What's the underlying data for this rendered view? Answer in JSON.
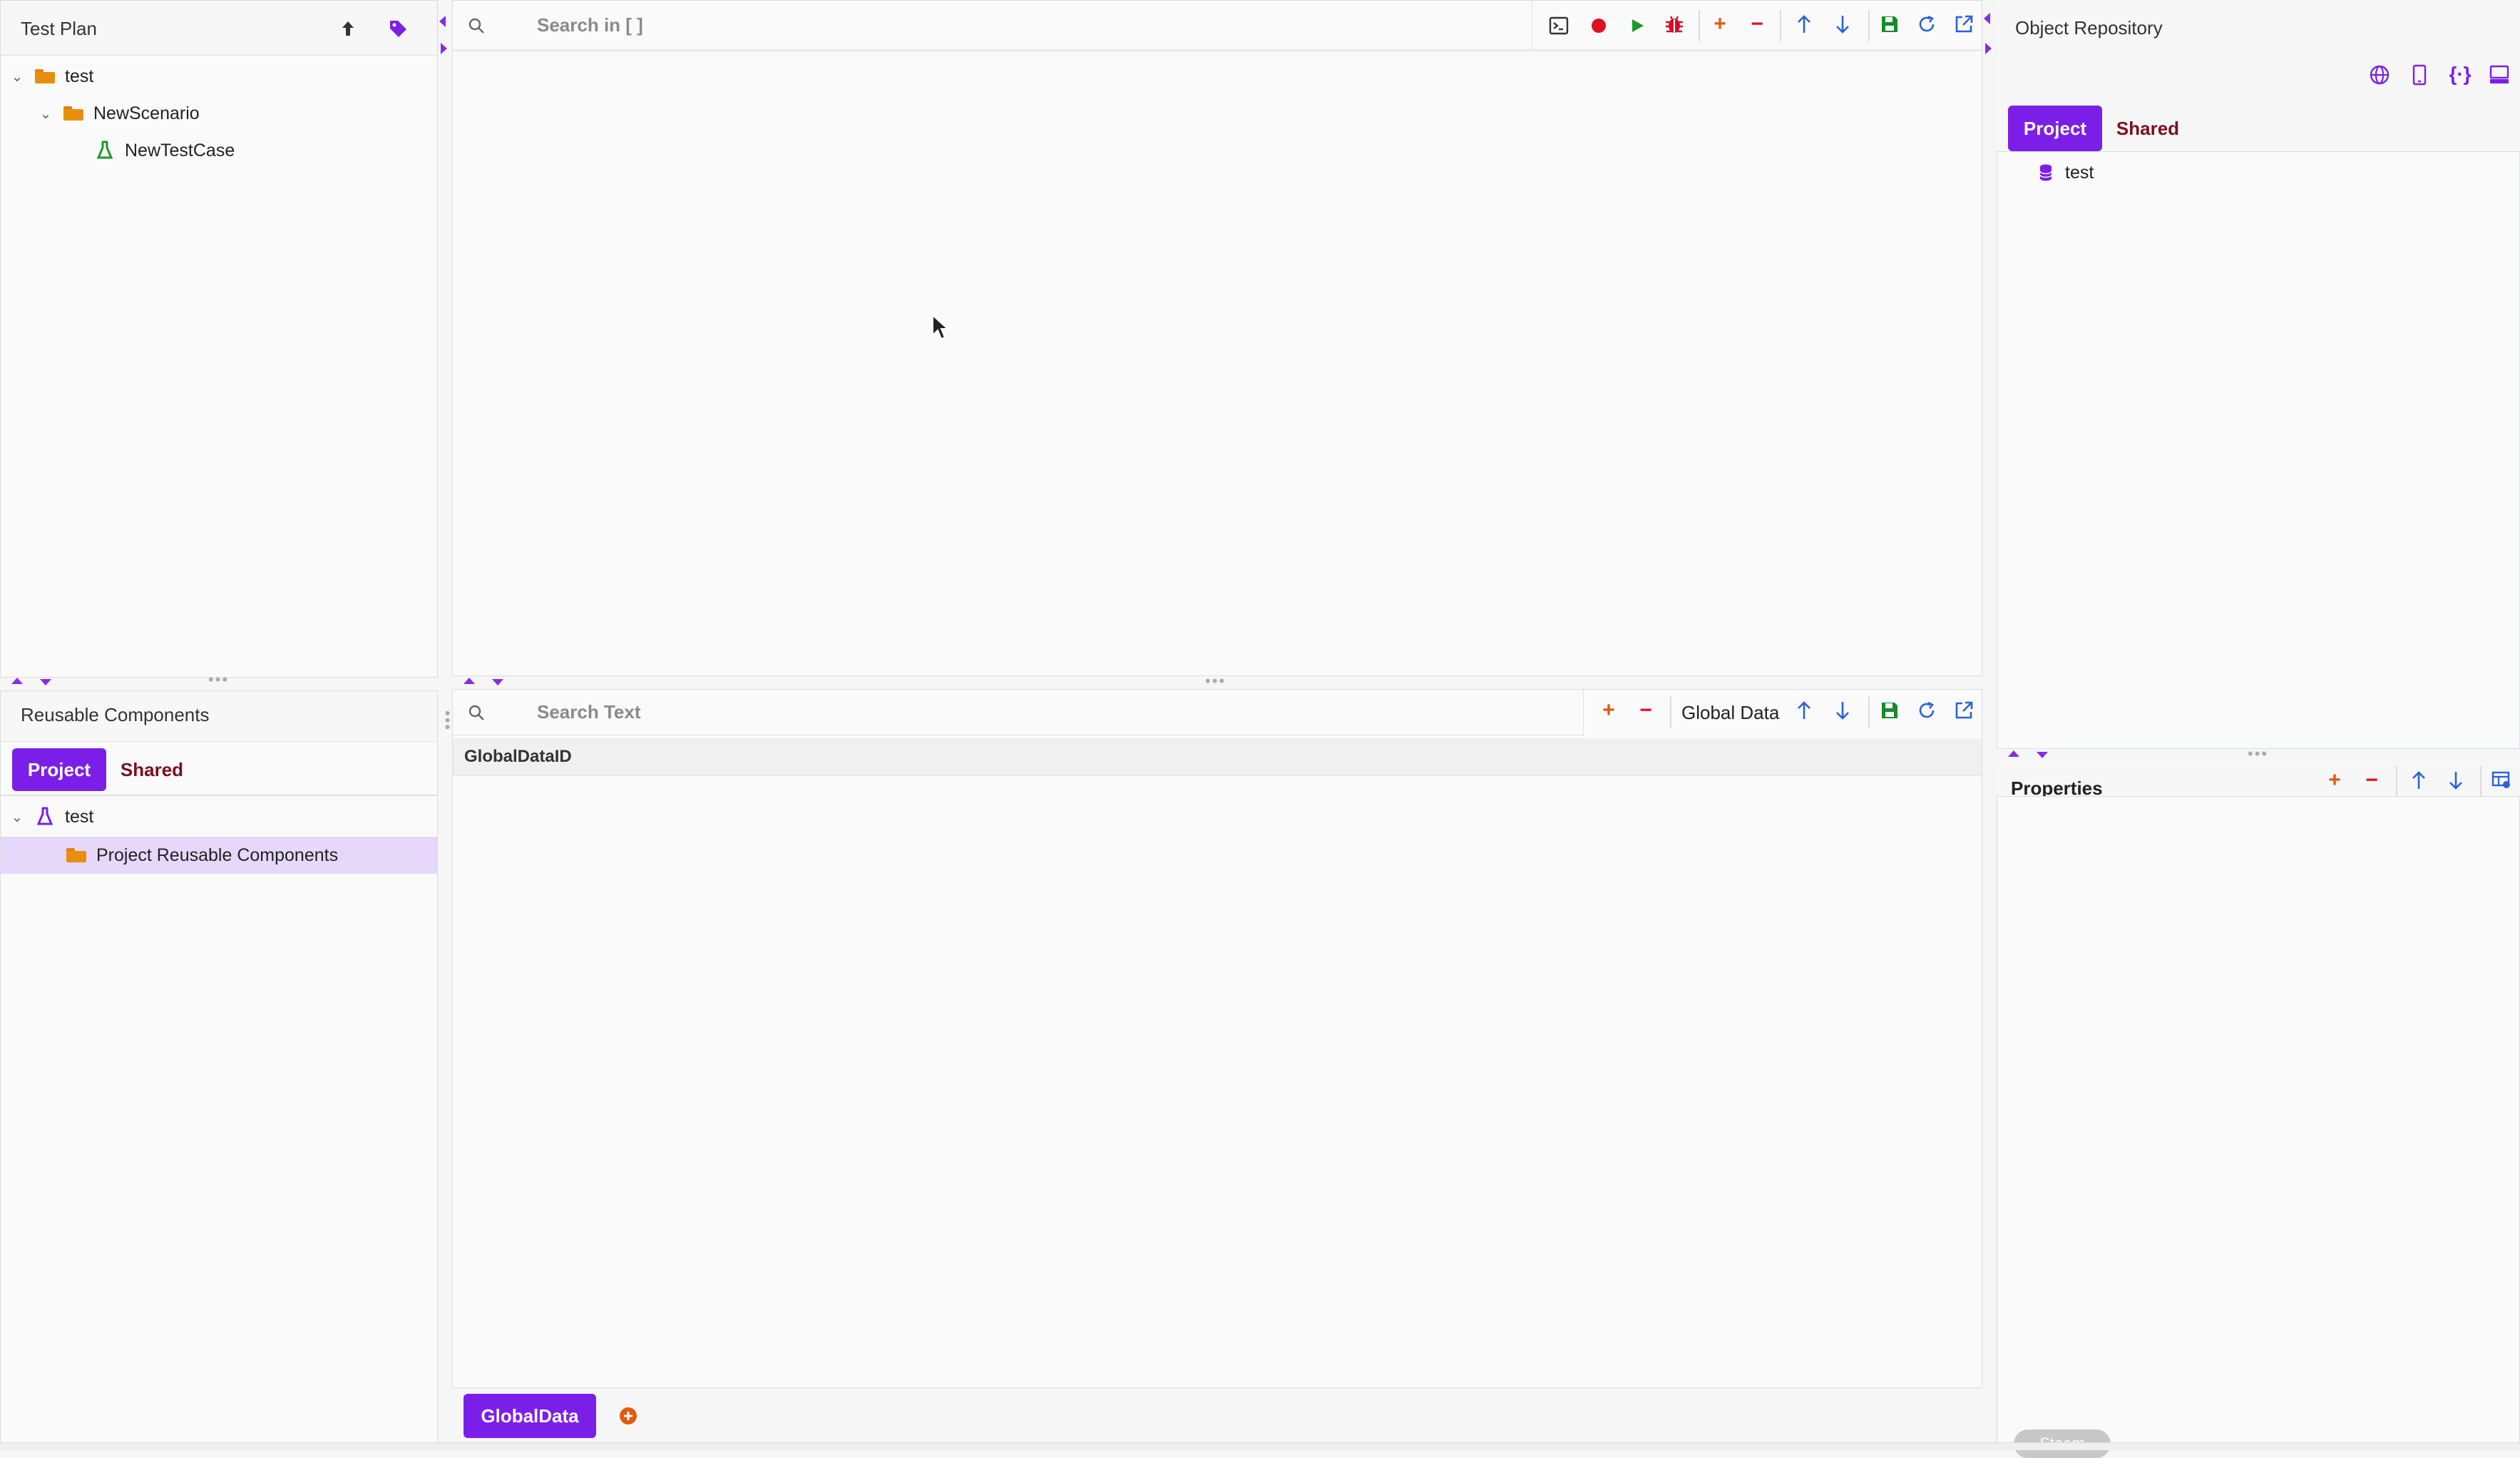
{
  "test_plan": {
    "title": "Test Plan",
    "tree": [
      {
        "label": "test"
      },
      {
        "label": "NewScenario"
      },
      {
        "label": "NewTestCase"
      }
    ]
  },
  "editor": {
    "search_placeholder": "Search in [ ]"
  },
  "reusable": {
    "title": "Reusable Components",
    "tabs": [
      "Project",
      "Shared"
    ],
    "tree": [
      {
        "label": "test"
      },
      {
        "label": "Project Reusable Components"
      }
    ]
  },
  "data_panel": {
    "search_placeholder": "Search Text",
    "dataset_label": "Global Data",
    "column_header": "GlobalDataID",
    "bottom_tab": "GlobalData"
  },
  "object_repo": {
    "title": "Object Repository",
    "tabs": [
      "Project",
      "Shared"
    ],
    "tree": [
      {
        "label": "test"
      }
    ]
  },
  "properties": {
    "title": "Properties"
  },
  "status": {
    "pill": "Steam"
  },
  "colors": {
    "accent": "#7b1fe8",
    "record": "#e01020",
    "run": "#1a9a2a",
    "save": "#188a2a",
    "add": "#e05a10",
    "link": "#2a62d8"
  }
}
